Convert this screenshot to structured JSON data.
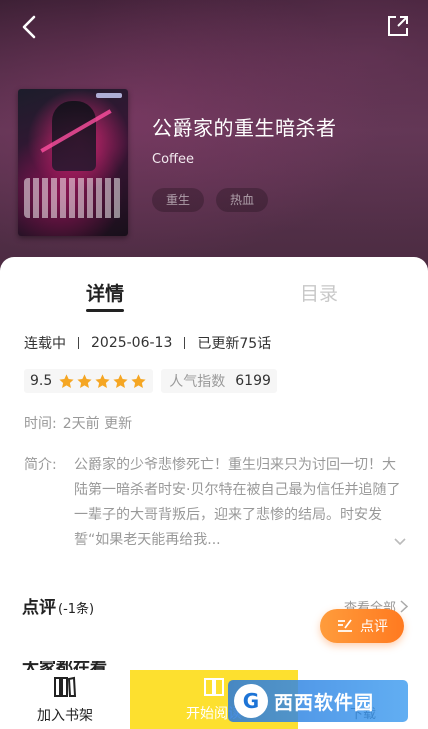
{
  "header": {
    "back_icon": "back-arrow-icon",
    "share_icon": "share-icon"
  },
  "book": {
    "title": "公爵家的重生暗杀者",
    "author": "Coffee",
    "tags": [
      "重生",
      "热血"
    ]
  },
  "tabs": [
    {
      "label": "详情",
      "active": true
    },
    {
      "label": "目录",
      "active": false
    }
  ],
  "meta": {
    "status": "连载中",
    "date": "2025-06-13",
    "updated": "已更新75话"
  },
  "rating": {
    "score": "9.5",
    "stars": 5,
    "star_color": "#f5a623",
    "popularity_label": "人气指数",
    "popularity_value": "6199"
  },
  "time": {
    "label": "时间:",
    "value": "2天前 更新"
  },
  "intro": {
    "label": "简介:",
    "text": "公爵家的少爷悲惨死亡！重生归来只为讨回一切！大陆第一暗杀者时安·贝尔特在被自己最为信任并追随了一辈子的大哥背叛后，迎来了悲惨的结局。时安发誓“如果老天能再给我..."
  },
  "reviews": {
    "title": "点评",
    "count": "(-1条)",
    "view_all": "查看全部",
    "review_button": "点评",
    "accent": "#ff8a2a"
  },
  "next_section": {
    "title": "大家都在看"
  },
  "bottom_bar": {
    "add_shelf": "加入书架",
    "start_read": "开始阅读",
    "download": "下载",
    "start_color": "#fde02f"
  },
  "watermark": {
    "logo": "G",
    "text": "西西软件园"
  }
}
